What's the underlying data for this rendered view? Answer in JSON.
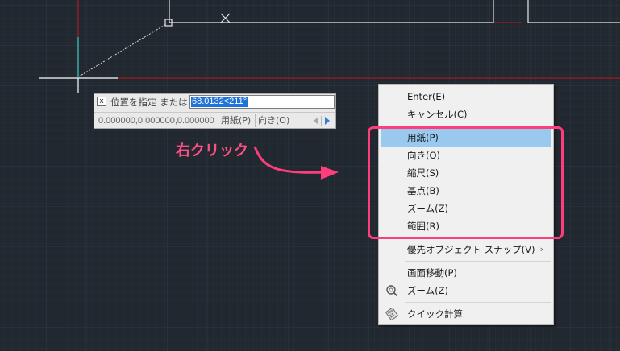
{
  "command_prompt": {
    "close_glyph": "x",
    "label": "位置を指定 または",
    "input_value": "68.0132<211°",
    "coordinates": "0.000000,0.000000,0.000000",
    "option_paper": "用紙(P)",
    "option_direction": "向き(O)"
  },
  "annotation": {
    "text": "右クリック",
    "color": "#ff4f87"
  },
  "context_menu": {
    "enter": "Enter(E)",
    "cancel": "キャンセル(C)",
    "paper": "用紙(P)",
    "direction": "向き(O)",
    "scale": "縮尺(S)",
    "base_point": "基点(B)",
    "zoom_sub": "ズーム(Z)",
    "range": "範囲(R)",
    "osnap": "優先オブジェクト スナップ(V)",
    "pan": "画面移動(P)",
    "zoom": "ズーム(Z)",
    "quickcalc": "クイック計算",
    "submenu_arrow": "›",
    "highlighted_item": "用紙(P)",
    "highlight_color": "#99c9ef",
    "frame_color": "#ff3d7c"
  },
  "icons": {
    "zoom": "zoom-magnifier-icon",
    "quickcalc": "calculator-icon",
    "close": "close-icon",
    "arrow_left": "arrow-left-icon",
    "arrow_right": "arrow-right-icon"
  },
  "colors": {
    "background": "#212830",
    "x_axis": "#c4171c",
    "y_axis": "#40c9c4",
    "crosshair": "#ffffff"
  }
}
